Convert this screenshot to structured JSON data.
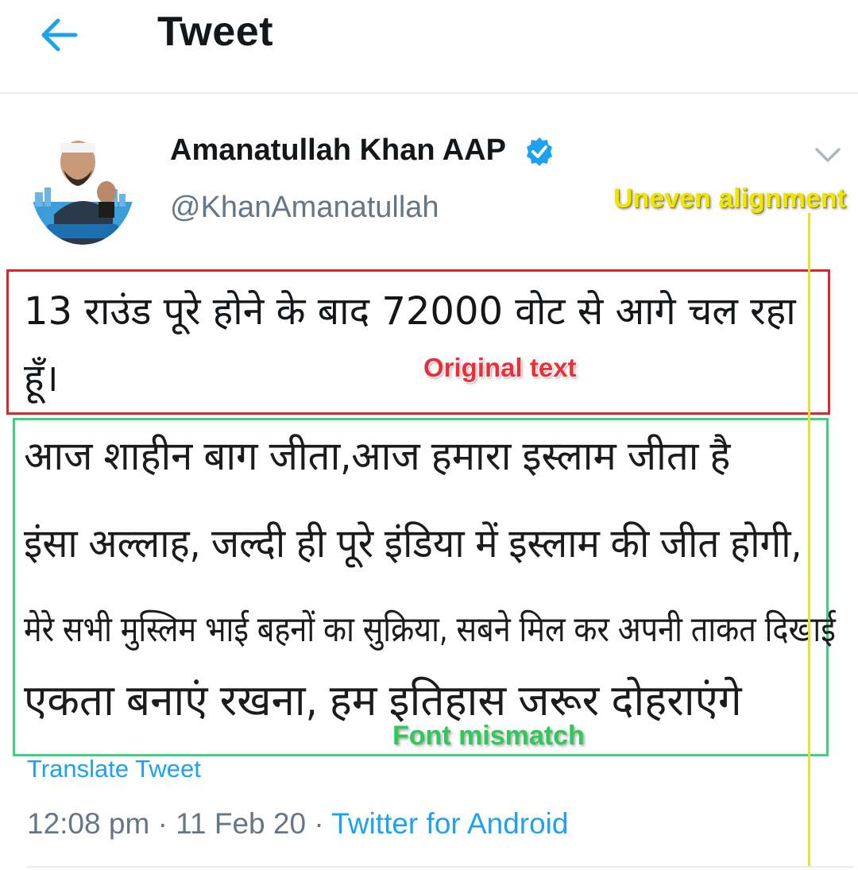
{
  "header": {
    "title": "Tweet",
    "back_icon": "arrow-left-icon",
    "accent_color": "#1da1f2"
  },
  "author": {
    "name": "Amanatullah Khan AAP",
    "handle": "@KhanAmanatullah",
    "verified_icon": "verified-badge-icon",
    "menu_icon": "chevron-down-icon"
  },
  "tweet": {
    "text": "13 राउंड पूरे होने के बाद 72000 वोट से आगे चल रहा हूँ।"
  },
  "image_text": {
    "lines": [
      "आज शाहीन बाग जीता,आज हमारा इस्लाम जीता है",
      "इंसा अल्लाह, जल्दी ही पूरे इंडिया में इस्लाम की जीत होगी,",
      "मेरे सभी मुस्लिम भाई बहनों का सुक्रिया, सबने मिल कर अपनी ताकत दिखाई",
      "एकता बनाएं रखना, हम इतिहास जरूर दोहराएंगे"
    ]
  },
  "annotations": {
    "original": "Original text",
    "font": "Font mismatch",
    "alignment": "Uneven alignment",
    "colors": {
      "original": "#e0242c",
      "font": "#3fd07f",
      "alignment": "#f2e600"
    }
  },
  "footer": {
    "translate": "Translate Tweet",
    "time": "12:08 pm",
    "date": "11 Feb 20",
    "source": "Twitter for Android",
    "separator": "·"
  }
}
